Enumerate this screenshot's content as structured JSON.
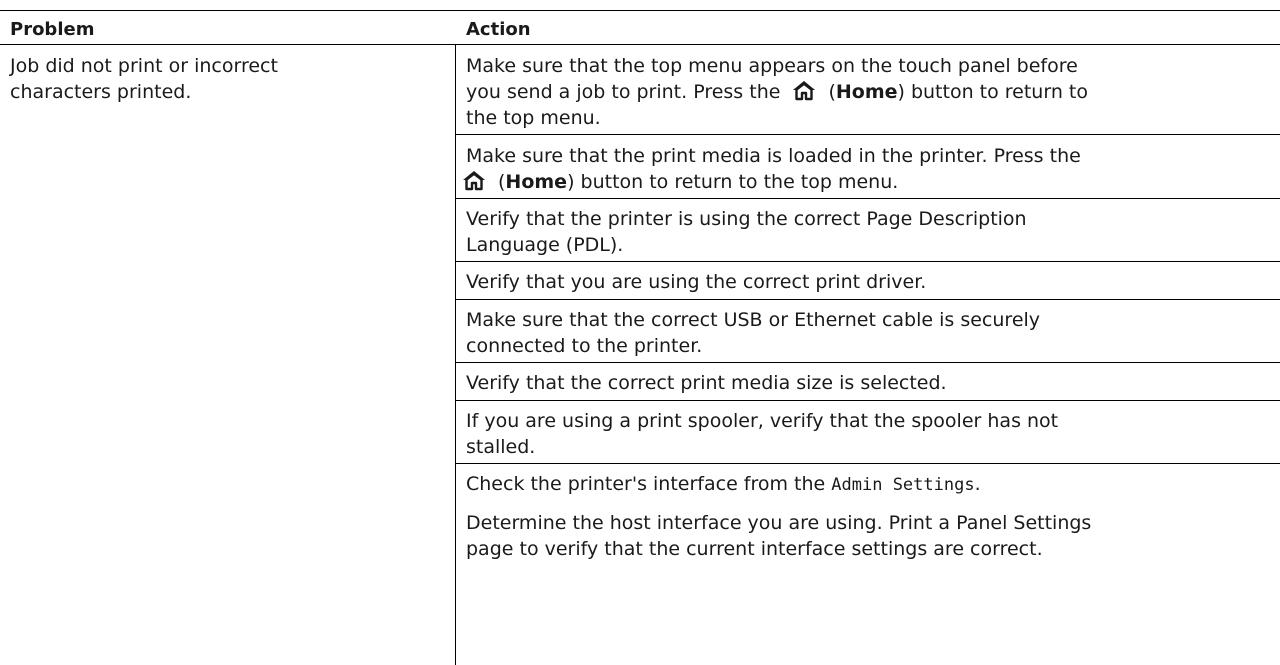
{
  "table": {
    "headers": {
      "problem": "Problem",
      "action": "Action"
    },
    "problem_text_lines": [
      "Job did not print or incorrect",
      "characters printed."
    ],
    "actions": [
      {
        "line1": "Make sure that the top menu appears on the touch panel before",
        "line2_pre": "you send a job to print. Press the",
        "open_paren": "(",
        "button_name": "Home",
        "line2_post": ") button to return to",
        "line3": "the top menu."
      },
      {
        "line1": "Make sure that the print media is loaded in the printer. Press the",
        "open_paren": "(",
        "button_name": "Home",
        "line2_post": ") button to return to the top menu."
      },
      {
        "line1": "Verify that the printer is using the correct Page Description",
        "line2": "Language (PDL)."
      },
      {
        "line1": "Verify that you are using the correct print driver."
      },
      {
        "line1": "Make sure that the correct USB or Ethernet cable is securely",
        "line2": "connected to the printer."
      },
      {
        "line1": "Verify that the correct print media size is selected."
      },
      {
        "line1": "If you are using a print spooler, verify that the spooler has not",
        "line2": "stalled."
      },
      {
        "line1_pre": "Check the printer's interface from the",
        "menu_name": "Admin Settings",
        "line1_post": "."
      },
      {
        "line1": "Determine the host interface you are using. Print a Panel Settings",
        "line2": "page to verify that the current interface settings are correct."
      }
    ]
  },
  "icons": {
    "home": "home-icon"
  }
}
